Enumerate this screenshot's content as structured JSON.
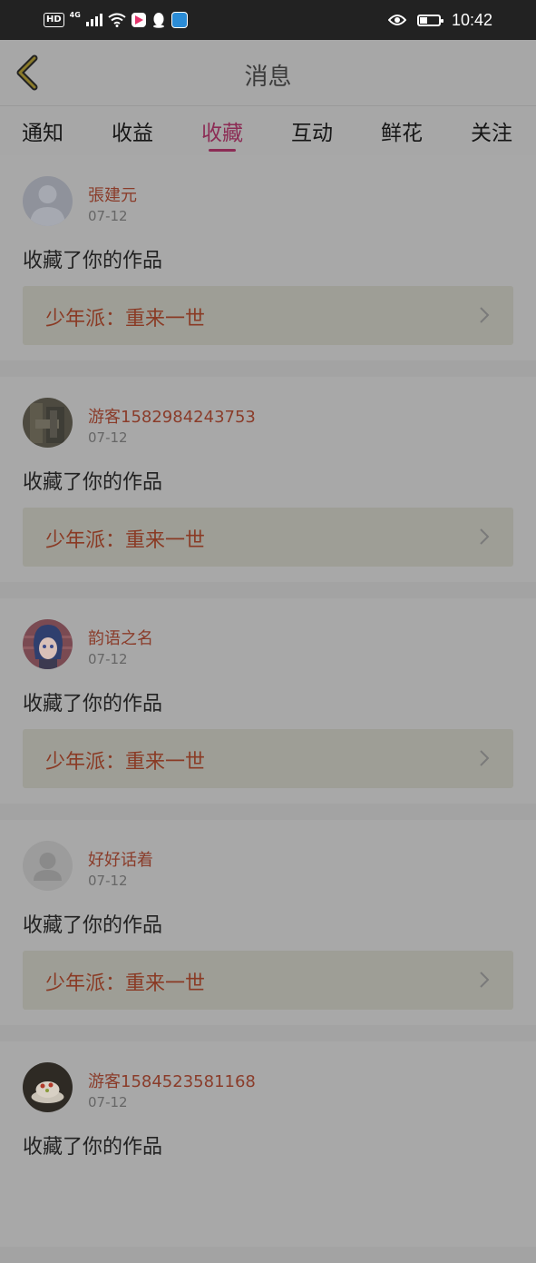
{
  "status_bar": {
    "hd": "HD",
    "network": "4G",
    "time": "10:42",
    "battery_level": 0.4
  },
  "header": {
    "title": "消息",
    "back_icon": "chevron-left-icon"
  },
  "tabs": [
    {
      "label": "通知",
      "active": false
    },
    {
      "label": "收益",
      "active": false
    },
    {
      "label": "收藏",
      "active": true
    },
    {
      "label": "互动",
      "active": false
    },
    {
      "label": "鲜花",
      "active": false
    },
    {
      "label": "关注",
      "active": false
    }
  ],
  "messages": [
    {
      "user": "張建元",
      "date": "07-12",
      "action": "收藏了你的作品",
      "work": "少年派：重来一世",
      "avatar": "default-avatar"
    },
    {
      "user": "游客1582984243753",
      "date": "07-12",
      "action": "收藏了你的作品",
      "work": "少年派：重来一世",
      "avatar": "photo-avatar"
    },
    {
      "user": "韵语之名",
      "date": "07-12",
      "action": "收藏了你的作品",
      "work": "少年派：重来一世",
      "avatar": "anime-avatar"
    },
    {
      "user": "好好话着",
      "date": "07-12",
      "action": "收藏了你的作品",
      "work": "少年派：重来一世",
      "avatar": "default-avatar"
    },
    {
      "user": "游客1584523581168",
      "date": "07-12",
      "action": "收藏了你的作品",
      "work": "",
      "avatar": "cake-avatar"
    }
  ],
  "colors": {
    "accent": "#8c2c55",
    "username": "#8a3c2a",
    "work_title": "#8a3a24"
  }
}
